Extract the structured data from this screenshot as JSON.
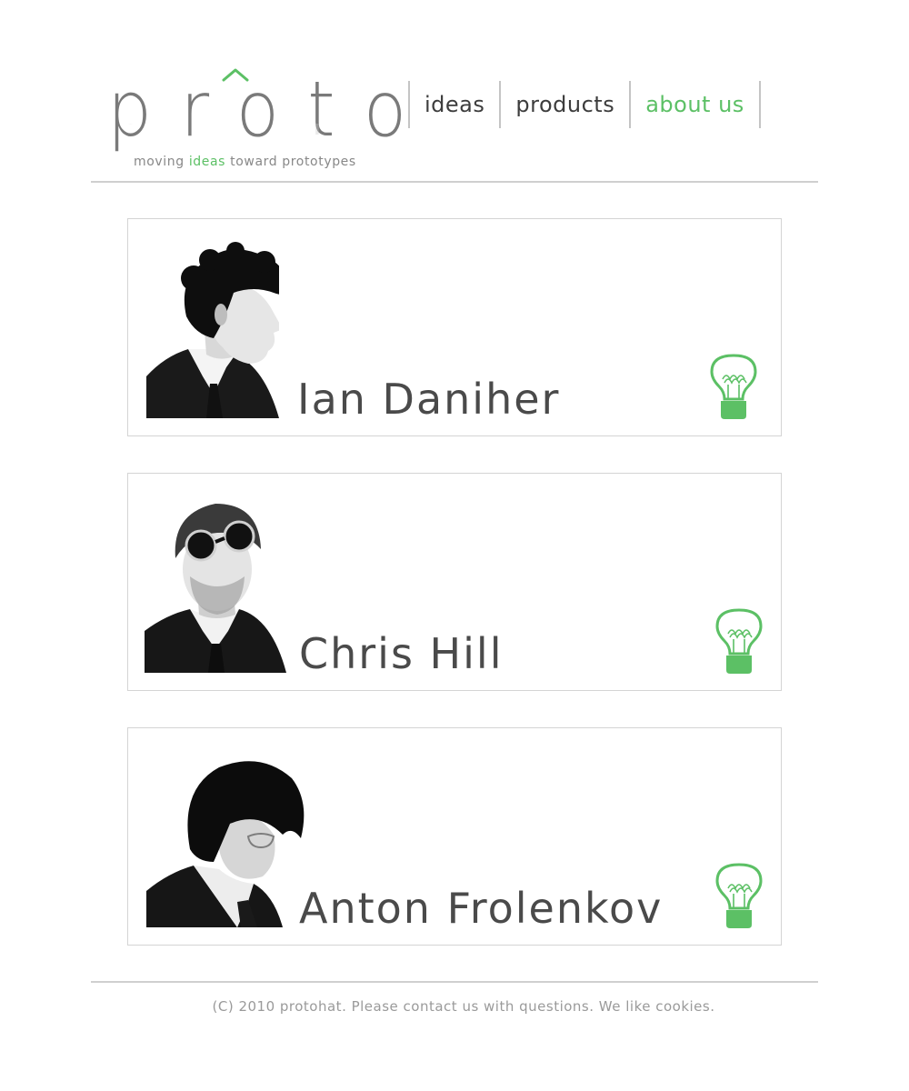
{
  "brand": {
    "logo_text": "proto",
    "tagline_before": "moving",
    "tagline_accent": "ideas",
    "tagline_after": "toward prototypes"
  },
  "nav": {
    "items": [
      {
        "label": "ideas",
        "active": false
      },
      {
        "label": "products",
        "active": false
      },
      {
        "label": "about us",
        "active": true
      }
    ]
  },
  "team": [
    {
      "name": "Ian Daniher",
      "photo_icon": "person-portrait-icon",
      "badge_icon": "lightbulb-icon"
    },
    {
      "name": "Chris Hill",
      "photo_icon": "person-portrait-icon",
      "badge_icon": "lightbulb-icon"
    },
    {
      "name": "Anton Frolenkov",
      "photo_icon": "person-portrait-icon",
      "badge_icon": "lightbulb-icon"
    }
  ],
  "footer": {
    "text": "(C) 2010 protohat. Please contact us with questions. We like cookies."
  },
  "colors": {
    "accent": "#5cc065",
    "text": "#444444",
    "rule": "#cfcfcf",
    "card_border": "#d4d4d4"
  }
}
